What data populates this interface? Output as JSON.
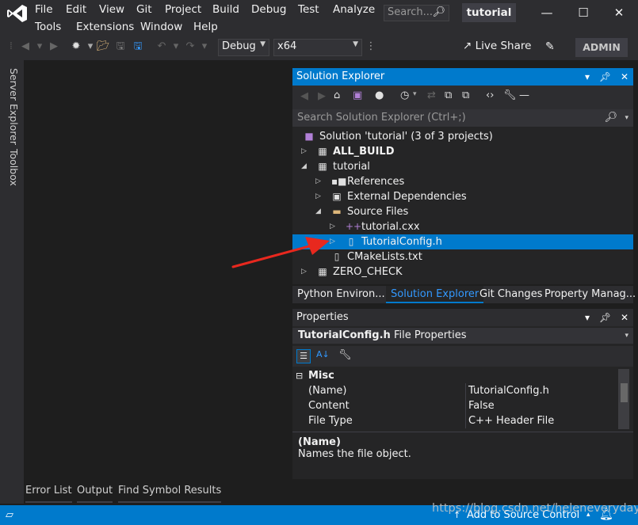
{
  "menu": {
    "file": "File",
    "edit": "Edit",
    "view": "View",
    "git": "Git",
    "project": "Project",
    "build": "Build",
    "debug": "Debug",
    "test": "Test",
    "analyze": "Analyze",
    "tools": "Tools",
    "extensions": "Extensions",
    "window": "Window",
    "help": "Help"
  },
  "search": {
    "placeholder": "Search..."
  },
  "project_title": "tutorial",
  "toolbar": {
    "config": "Debug",
    "platform": "x64",
    "live_share": "Live Share",
    "user": "ADMIN"
  },
  "side_tabs": {
    "server_explorer": "Server Explorer",
    "toolbox": "Toolbox"
  },
  "solution_explorer": {
    "title": "Solution Explorer",
    "search_placeholder": "Search Solution Explorer (Ctrl+;)",
    "tree": [
      {
        "label": "Solution 'tutorial' (3 of 3 projects)",
        "icon": "solution-icon",
        "indent": 0,
        "expander": ""
      },
      {
        "label": "ALL_BUILD",
        "icon": "cmake-project-icon",
        "indent": 0,
        "expander": "collapsed",
        "bold": true
      },
      {
        "label": "tutorial",
        "icon": "cmake-project-icon",
        "indent": 0,
        "expander": "expanded"
      },
      {
        "label": "References",
        "icon": "references-icon",
        "indent": 1,
        "expander": "collapsed"
      },
      {
        "label": "External Dependencies",
        "icon": "external-deps-icon",
        "indent": 1,
        "expander": "collapsed"
      },
      {
        "label": "Source Files",
        "icon": "folder-icon",
        "indent": 1,
        "expander": "expanded"
      },
      {
        "label": "tutorial.cxx",
        "icon": "cpp-file-icon",
        "indent": 2,
        "expander": "collapsed"
      },
      {
        "label": "TutorialConfig.h",
        "icon": "header-file-icon",
        "indent": 2,
        "expander": "collapsed",
        "selected": true
      },
      {
        "label": "CMakeLists.txt",
        "icon": "text-file-icon",
        "indent": 1,
        "expander": ""
      },
      {
        "label": "ZERO_CHECK",
        "icon": "cmake-project-icon",
        "indent": 0,
        "expander": "collapsed"
      }
    ]
  },
  "tool_tabs": [
    "Python Environ...",
    "Solution Explorer",
    "Git Changes",
    "Property Manag..."
  ],
  "properties": {
    "title": "Properties",
    "object_name": "TutorialConfig.h",
    "object_type": "File Properties",
    "category": "Misc",
    "rows": [
      {
        "name": "(Name)",
        "value": "TutorialConfig.h"
      },
      {
        "name": "Content",
        "value": "False"
      },
      {
        "name": "File Type",
        "value": "C++ Header File"
      }
    ],
    "desc_title": "(Name)",
    "desc_text": "Names the file object."
  },
  "bottom_tabs": [
    "Error List",
    "Output",
    "Find Symbol Results"
  ],
  "status": {
    "source_control": "Add to Source Control"
  },
  "watermark": "https://blog.csdn.net/heleneveryday",
  "colors": {
    "accent": "#007acc",
    "background": "#1e1e1e",
    "chrome": "#2d2d30",
    "arrow": "#e8281e"
  }
}
